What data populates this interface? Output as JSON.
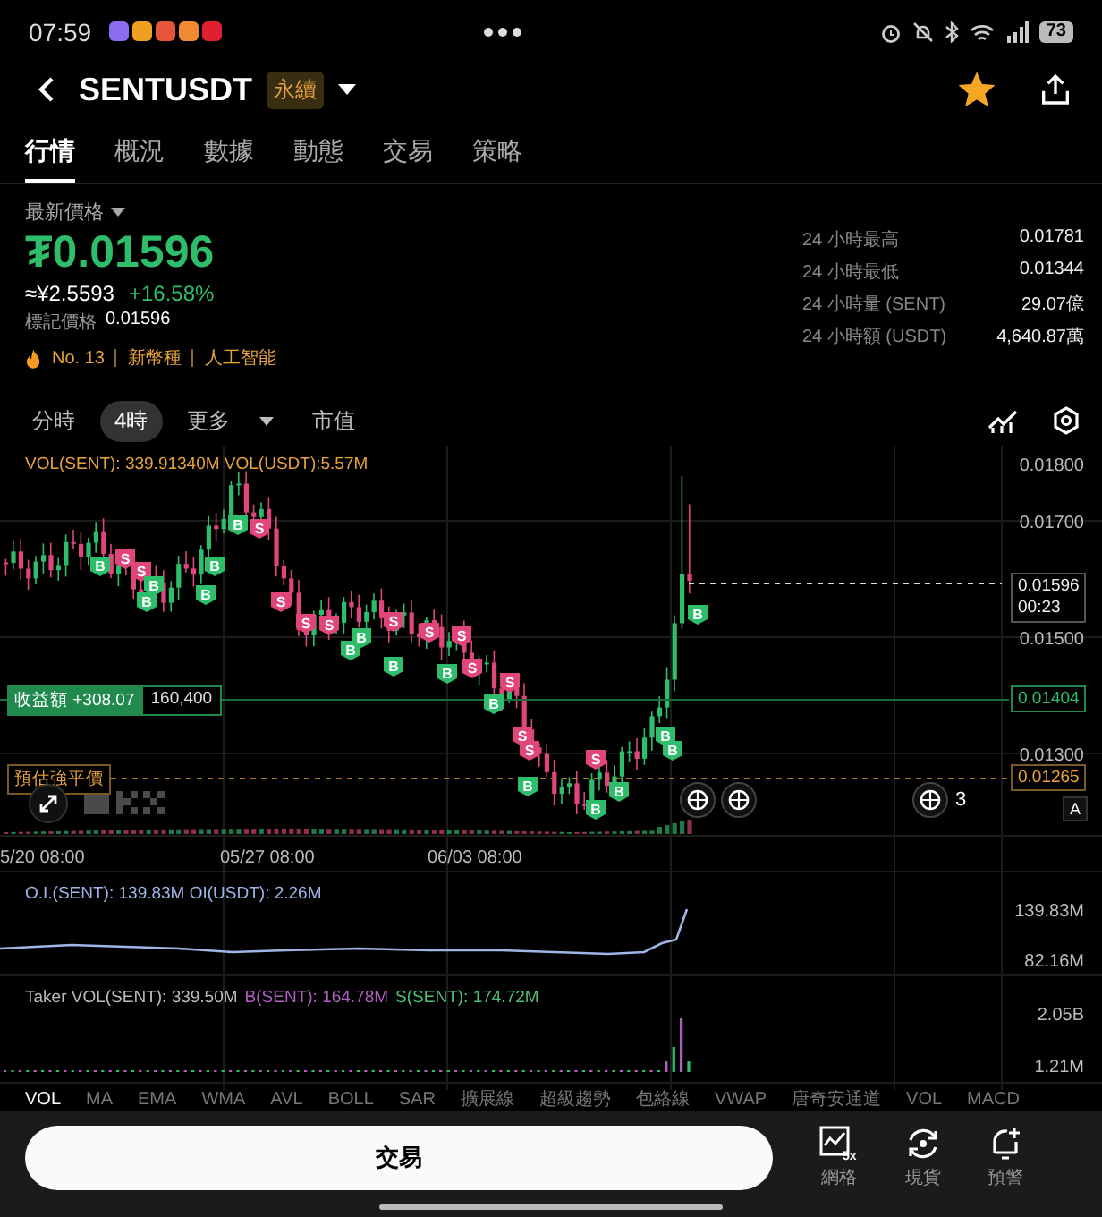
{
  "status_bar": {
    "time": "07:59",
    "battery": "73"
  },
  "header": {
    "symbol": "SENTUSDT",
    "badge": "永續",
    "favorite": true
  },
  "tabs": [
    {
      "label": "行情",
      "selected": true
    },
    {
      "label": "概況",
      "selected": false
    },
    {
      "label": "數據",
      "selected": false
    },
    {
      "label": "動態",
      "selected": false
    },
    {
      "label": "交易",
      "selected": false
    },
    {
      "label": "策略",
      "selected": false
    }
  ],
  "price": {
    "label": "最新價格",
    "last": "₮0.01596",
    "approx": "≈¥2.5593",
    "change": "+16.58%",
    "mark_label": "標記價格",
    "mark_value": "0.01596",
    "tags": [
      "No. 13",
      "新幣種",
      "人工智能"
    ]
  },
  "stats": [
    {
      "label": "24 小時最高",
      "value": "0.01781"
    },
    {
      "label": "24 小時最低",
      "value": "0.01344"
    },
    {
      "label": "24 小時量 (SENT)",
      "value": "29.07億"
    },
    {
      "label": "24 小時額 (USDT)",
      "value": "4,640.87萬"
    }
  ],
  "timeframes": [
    {
      "label": "分時",
      "selected": false,
      "kind": "plain"
    },
    {
      "label": "4時",
      "selected": true,
      "kind": "plain"
    },
    {
      "label": "更多",
      "selected": false,
      "kind": "dropdown"
    },
    {
      "label": "市值",
      "selected": false,
      "kind": "plain"
    }
  ],
  "chart": {
    "legend": "VOL(SENT): 339.91340M VOL(USDT):5.57M",
    "price_ticks": [
      "0.01800",
      "0.01700",
      "0.01500",
      "0.01300"
    ],
    "last_price": "0.01596",
    "countdown": "00:23",
    "position": {
      "label": "收益額",
      "pnl": "+308.07",
      "size": "160,400",
      "price": "0.01404"
    },
    "liquidation": {
      "label": "預估強平價",
      "price": "0.01265"
    },
    "markers": [
      {
        "kind": "buy",
        "label": "B"
      },
      {
        "kind": "sell",
        "label": "S"
      },
      {
        "kind": "sell",
        "label": "S"
      },
      {
        "kind": "buy",
        "label": "B"
      },
      {
        "kind": "buy",
        "label": "B"
      },
      {
        "kind": "buy",
        "label": "B"
      },
      {
        "kind": "buy",
        "label": "B"
      },
      {
        "kind": "buy",
        "label": "B"
      },
      {
        "kind": "sell",
        "label": "S"
      },
      {
        "kind": "sell",
        "label": "S"
      },
      {
        "kind": "sell",
        "label": "S"
      },
      {
        "kind": "sell",
        "label": "S"
      },
      {
        "kind": "buy",
        "label": "B"
      },
      {
        "kind": "buy",
        "label": "B"
      },
      {
        "kind": "sell",
        "label": "S"
      },
      {
        "kind": "buy",
        "label": "B"
      },
      {
        "kind": "sell",
        "label": "S"
      },
      {
        "kind": "sell",
        "label": "S"
      },
      {
        "kind": "buy",
        "label": "B"
      },
      {
        "kind": "sell",
        "label": "S"
      },
      {
        "kind": "sell",
        "label": "S"
      },
      {
        "kind": "buy",
        "label": "B"
      },
      {
        "kind": "sell",
        "label": "S"
      },
      {
        "kind": "sell",
        "label": "S"
      },
      {
        "kind": "buy",
        "label": "B"
      },
      {
        "kind": "sell",
        "label": "S"
      },
      {
        "kind": "buy",
        "label": "B"
      },
      {
        "kind": "buy",
        "label": "B"
      },
      {
        "kind": "buy",
        "label": "B"
      },
      {
        "kind": "buy",
        "label": "B"
      },
      {
        "kind": "buy",
        "label": "B"
      }
    ],
    "event_count": "3",
    "scale_mode": "A",
    "dates": [
      "5/20 08:00",
      "05/27 08:00",
      "06/03 08:00"
    ]
  },
  "oi": {
    "legend": "O.I.(SENT): 139.83M OI(USDT): 2.26M",
    "ticks": [
      "139.83M",
      "82.16M"
    ]
  },
  "taker": {
    "total": "Taker VOL(SENT): 339.50M",
    "buy": "B(SENT): 164.78M",
    "sell": "S(SENT): 174.72M",
    "ticks": [
      "2.05B",
      "1.21M"
    ]
  },
  "indicators": [
    {
      "label": "VOL",
      "selected": true
    },
    {
      "label": "MA",
      "selected": false
    },
    {
      "label": "EMA",
      "selected": false
    },
    {
      "label": "WMA",
      "selected": false
    },
    {
      "label": "AVL",
      "selected": false
    },
    {
      "label": "BOLL",
      "selected": false
    },
    {
      "label": "SAR",
      "selected": false
    },
    {
      "label": "擴展線",
      "selected": false
    },
    {
      "label": "超級趨勢",
      "selected": false
    },
    {
      "label": "包絡線",
      "selected": false
    },
    {
      "label": "VWAP",
      "selected": false
    },
    {
      "label": "唐奇安通道",
      "selected": false
    },
    {
      "label": "VOL",
      "selected": false
    },
    {
      "label": "MACD",
      "selected": false
    }
  ],
  "bottom_bar": {
    "trade_button": "交易",
    "actions": [
      {
        "label": "網格",
        "kind": "grid",
        "badge": "5x"
      },
      {
        "label": "現貨",
        "kind": "spot"
      },
      {
        "label": "預警",
        "kind": "alert"
      }
    ]
  }
}
